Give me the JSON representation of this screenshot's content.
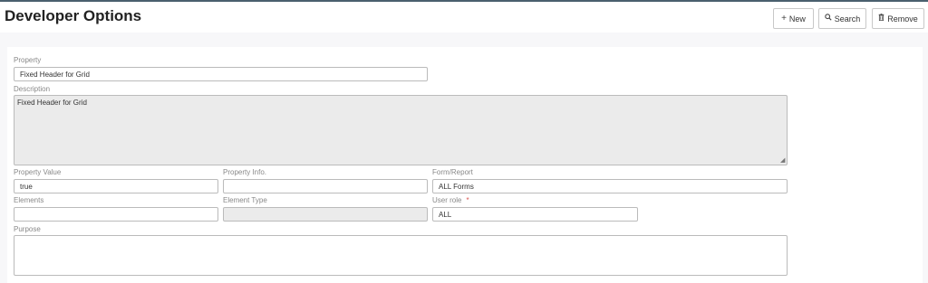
{
  "header": {
    "title": "Developer Options",
    "buttons": {
      "new": {
        "icon": "plus-icon",
        "label": "New"
      },
      "search": {
        "icon": "search-icon",
        "label": "Search"
      },
      "remove": {
        "icon": "trash-icon",
        "label": "Remove"
      }
    }
  },
  "form": {
    "property": {
      "label": "Property",
      "value": "Fixed Header for Grid"
    },
    "description": {
      "label": "Description",
      "value": "Fixed Header for Grid"
    },
    "property_value": {
      "label": "Property Value",
      "value": "true"
    },
    "property_info": {
      "label": "Property Info.",
      "value": ""
    },
    "form_report": {
      "label": "Form/Report",
      "value": "ALL Forms"
    },
    "elements": {
      "label": "Elements",
      "value": ""
    },
    "element_type": {
      "label": "Element Type",
      "value": ""
    },
    "user_role": {
      "label": "User role",
      "required_marker": "*",
      "value": "ALL"
    },
    "purpose": {
      "label": "Purpose",
      "value": ""
    }
  },
  "colors": {
    "top_line": "#4a5f6e",
    "required": "#d9534f",
    "disabled_bg": "#ebebeb"
  }
}
